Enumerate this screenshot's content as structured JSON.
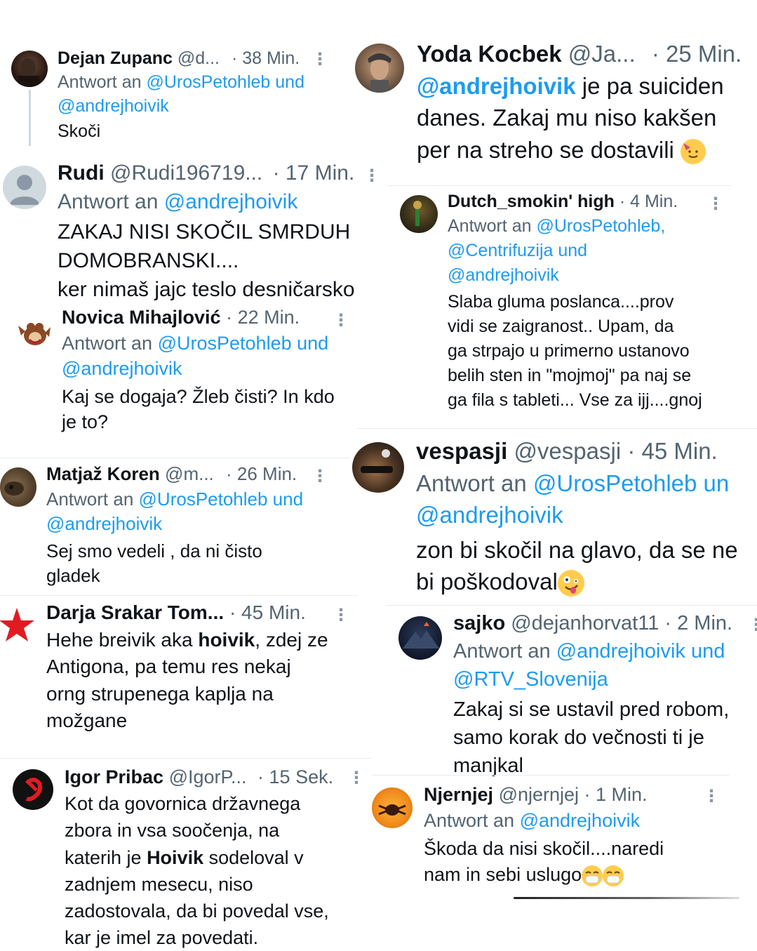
{
  "tweets": {
    "t1": {
      "name": "Dejan Zupanc",
      "handle": "@d...",
      "time": "· 38 Min.",
      "reply_prefix": "Antwort an",
      "reply1": "@UrosPetohleb und",
      "reply2": "@andrejhoivik",
      "text1": "Skoči"
    },
    "t2": {
      "name": "Rudi",
      "handle": "@Rudi196719...",
      "time": "· 17 Min.",
      "reply_prefix": "Antwort an",
      "reply1": "@andrejhoivik",
      "text1": "ZAKAJ NISI SKOČIL SMRDUH",
      "text2": "DOMOBRANSKI....",
      "text3": "ker nimaš jajc teslo desničarsko"
    },
    "t3": {
      "name": "Novica Mihajlović",
      "time": "· 22 Min.",
      "reply_prefix": "Antwort an",
      "reply1": "@UrosPetohleb und",
      "reply2": "@andrejhoivik",
      "text1": "Kaj se dogaja? Žleb čisti? In kdo",
      "text2": "je to?"
    },
    "t4": {
      "name": "Matjaž Koren",
      "handle": "@m...",
      "time": "· 26 Min.",
      "reply_prefix": "Antwort an",
      "reply1": "@UrosPetohleb und",
      "reply2": "@andrejhoivik",
      "text1": "Sej smo vedeli , da ni čisto",
      "text2": "gladek"
    },
    "t5": {
      "name": "Darja Srakar Tom...",
      "time": "· 45 Min.",
      "text1a": "Hehe breivik aka ",
      "text1b": "hoivik",
      "text1c": ", zdej ze",
      "text2": "Antigona, pa temu res nekaj",
      "text3": "orng strupenega kaplja na",
      "text4": "možgane"
    },
    "t6": {
      "name": "Igor Pribac",
      "handle": "@IgorP...",
      "time": "· 15 Sek.",
      "text1": "Kot da govornica državnega",
      "text2": "zbora in vsa soočenja, na",
      "text3a": "katerih je ",
      "text3b": "Hoivik",
      "text3c": " sodeloval v",
      "text4": "zadnjem mesecu, niso",
      "text5": "zadostovala, da bi povedal vse,",
      "text6": "kar je imel za povedati."
    },
    "t7": {
      "name": "Yoda Kocbek",
      "handle": "@Ja...",
      "time": "· 25 Min.",
      "mention": "@andrejhoivik",
      "text1": " je pa suiciden",
      "text2": "danes. Zakaj mu niso kakšen",
      "text3": "per na streho se dostavili"
    },
    "t8": {
      "name": "Dutch_smokin' high",
      "time": "· 4 Min.",
      "reply_prefix": "Antwort an",
      "reply1": "@UrosPetohleb,",
      "reply2": "@Centrifuzija und",
      "reply3": "@andrejhoivik",
      "text1": "Slaba gluma poslanca....prov",
      "text2": "vidi se  zaigranost..  Upam, da",
      "text3": "ga strpajo u primerno ustanovo",
      "text4": "belih sten in \"mojmoj\" pa naj se",
      "text5": "ga fila s tableti... Vse za ijj....gnoj"
    },
    "t9": {
      "name": "vespasji",
      "handle": "@vespasji",
      "time": "· 45 Min.",
      "reply_prefix": "Antwort an",
      "reply1": "@UrosPetohleb un",
      "reply2": "@andrejhoivik",
      "text1": "zon bi skočil na glavo, da se ne",
      "text2": "bi poškodoval"
    },
    "t10": {
      "name": "sajko",
      "handle": "@dejanhorvat11",
      "time": "· 2 Min.",
      "reply_prefix": "Antwort an",
      "reply1": "@andrejhoivik und",
      "reply2": "@RTV_Slovenija",
      "text1": "Zakaj si se ustavil pred robom,",
      "text2": "samo korak do večnosti ti je",
      "text3": "manjkal"
    },
    "t11": {
      "name": "Njernjej",
      "handle": "@njernjej",
      "time": "· 1 Min.",
      "reply_prefix": "Antwort an",
      "reply1": "@andrejhoivik",
      "text1": "Škoda da nisi skočil....naredi",
      "text2": "nam in sebi uslugo"
    }
  },
  "more_glyph": "⋮",
  "colors": {
    "mention": "#1d9bf0",
    "grey": "#536471",
    "text": "#0f1419"
  }
}
